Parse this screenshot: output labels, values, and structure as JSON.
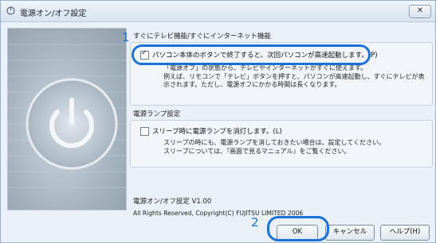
{
  "window": {
    "title": "電源オン/オフ設定",
    "close_label": "✕"
  },
  "quick": {
    "heading": "すぐにテレビ機能/すぐにインターネット機能",
    "checkbox_label": "パソコン本体のボタンで終了すると、次回パソコンが高速起動します。(P)",
    "checked": true,
    "desc": [
      "「電源オフ」の状態から、テレビやインターネットがすぐに使えます。",
      "例えば、リモコンで「テレビ」ボタンを押すと、パソコンが高速起動し、すぐにテレビが表",
      "示されます。ただし、電源オフにかかる時間は長くなります。"
    ]
  },
  "lamp": {
    "heading": "電源ランプ設定",
    "checkbox_label": "スリープ時に電源ランプを消灯します。(L)",
    "checked": false,
    "desc": [
      "スリープの時にも、電源ランプを消しておきたい場合は、設定してください。",
      "スリープについては、『画面で見るマニュアル』をご覧ください。"
    ]
  },
  "footer": {
    "version": "電源オン/オフ設定 V1.00",
    "copyright": "All Rights Reserved, Copyright(C) FUJITSU LIMITED 2006"
  },
  "buttons": {
    "ok": "OK",
    "cancel": "キャンセル",
    "help": "ヘルプ(H)"
  },
  "steps": {
    "one": "1",
    "two": "2"
  },
  "colors": {
    "highlight": "#1a72d8"
  },
  "icons": {
    "power": "power-icon",
    "app": "power-settings-icon"
  }
}
